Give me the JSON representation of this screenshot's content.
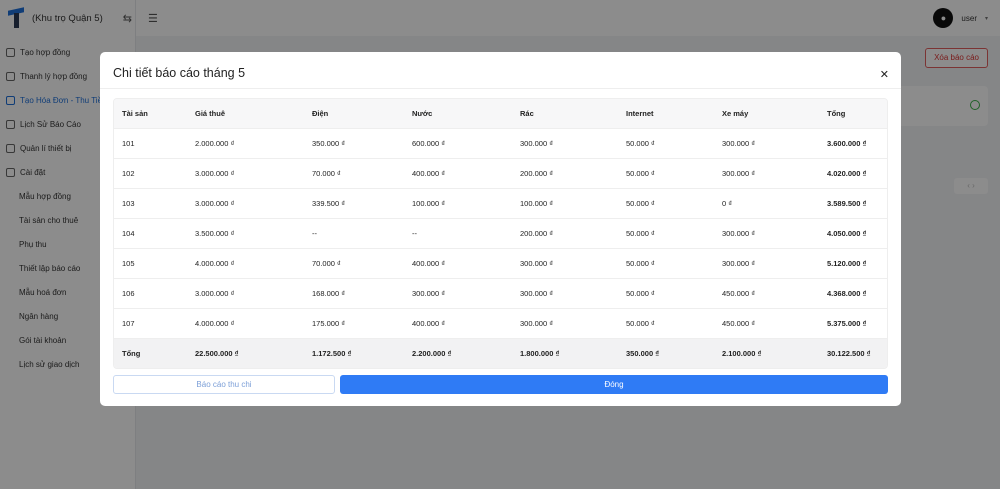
{
  "app": {
    "brand": "(Khu trọ Quận 5)",
    "user": "user"
  },
  "sidebar": {
    "items": [
      {
        "label": "Tạo hợp đồng",
        "icon": "contract-icon",
        "sub": false,
        "active": false
      },
      {
        "label": "Thanh lý hợp đồng",
        "icon": "terminate-icon",
        "sub": false,
        "active": false
      },
      {
        "label": "Tạo Hóa Đơn - Thu Tiền",
        "icon": "invoice-icon",
        "sub": false,
        "active": true
      },
      {
        "label": "Lịch Sử Báo Cáo",
        "icon": "history-icon",
        "sub": false,
        "active": false
      },
      {
        "label": "Quản lí thiết bị",
        "icon": "device-icon",
        "sub": false,
        "active": false
      },
      {
        "label": "Cài đặt",
        "icon": "settings-icon",
        "sub": false,
        "active": false
      },
      {
        "label": "Mẫu hợp đồng",
        "icon": "",
        "sub": true,
        "active": false
      },
      {
        "label": "Tài sản cho thuê",
        "icon": "",
        "sub": true,
        "active": false
      },
      {
        "label": "Phụ thu",
        "icon": "",
        "sub": true,
        "active": false
      },
      {
        "label": "Thiết lập báo cáo",
        "icon": "",
        "sub": true,
        "active": false
      },
      {
        "label": "Mẫu hoá đơn",
        "icon": "",
        "sub": true,
        "active": false
      },
      {
        "label": "Ngân hàng",
        "icon": "",
        "sub": true,
        "active": false
      },
      {
        "label": "Gói tài khoản",
        "icon": "",
        "sub": true,
        "active": false
      },
      {
        "label": "Lịch sử giao dịch",
        "icon": "",
        "sub": true,
        "active": false
      }
    ]
  },
  "background": {
    "delete_label": "Xóa báo cáo"
  },
  "modal": {
    "title": "Chi tiết báo cáo tháng 5",
    "columns": [
      "Tài sản",
      "Giá thuê",
      "Điện",
      "Nước",
      "Rác",
      "Internet",
      "Xe máy",
      "Tổng"
    ],
    "rows": [
      [
        "101",
        "2.000.000 ₫",
        "350.000 ₫",
        "600.000 ₫",
        "300.000 ₫",
        "50.000 ₫",
        "300.000 ₫",
        "3.600.000 ₫"
      ],
      [
        "102",
        "3.000.000 ₫",
        "70.000 ₫",
        "400.000 ₫",
        "200.000 ₫",
        "50.000 ₫",
        "300.000 ₫",
        "4.020.000 ₫"
      ],
      [
        "103",
        "3.000.000 ₫",
        "339.500 ₫",
        "100.000 ₫",
        "100.000 ₫",
        "50.000 ₫",
        "0 ₫",
        "3.589.500 ₫"
      ],
      [
        "104",
        "3.500.000 ₫",
        "--",
        "--",
        "200.000 ₫",
        "50.000 ₫",
        "300.000 ₫",
        "4.050.000 ₫"
      ],
      [
        "105",
        "4.000.000 ₫",
        "70.000 ₫",
        "400.000 ₫",
        "300.000 ₫",
        "50.000 ₫",
        "300.000 ₫",
        "5.120.000 ₫"
      ],
      [
        "106",
        "3.000.000 ₫",
        "168.000 ₫",
        "300.000 ₫",
        "300.000 ₫",
        "50.000 ₫",
        "450.000 ₫",
        "4.368.000 ₫"
      ],
      [
        "107",
        "4.000.000 ₫",
        "175.000 ₫",
        "400.000 ₫",
        "300.000 ₫",
        "50.000 ₫",
        "450.000 ₫",
        "5.375.000 ₫"
      ]
    ],
    "total_row": [
      "Tổng",
      "22.500.000 ₫",
      "1.172.500 ₫",
      "2.200.000 ₫",
      "1.800.000 ₫",
      "350.000 ₫",
      "2.100.000 ₫",
      "30.122.500 ₫"
    ],
    "report_button": "Báo cáo thu chi",
    "close_button": "Đóng"
  }
}
